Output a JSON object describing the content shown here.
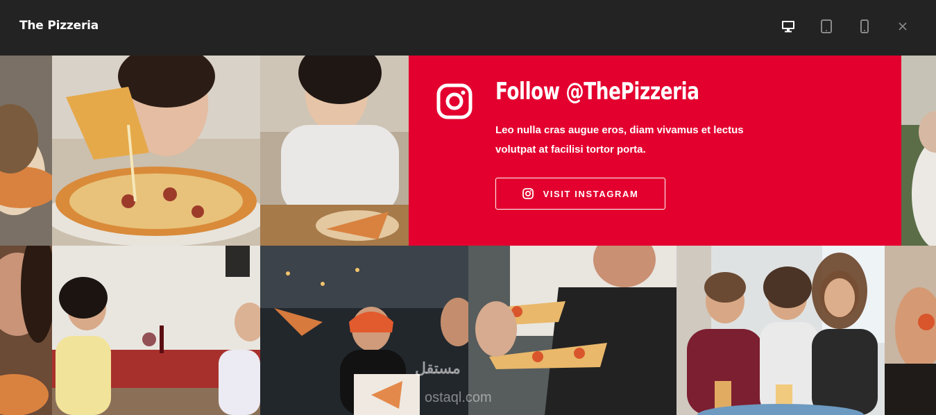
{
  "app": {
    "title": "The Pizzeria"
  },
  "toolbar": {
    "icons": [
      "desktop-icon",
      "tablet-icon",
      "mobile-icon",
      "close-icon"
    ]
  },
  "promo": {
    "title": "Follow @ThePizzeria",
    "text": "Leo nulla cras augue eros, diam vivamus et lectus volutpat at facilisi tortor porta.",
    "button_label": "VISIT INSTAGRAM",
    "background": "#e3002f"
  },
  "watermark": {
    "line1": "مستقل",
    "line2": "ostaql.com"
  },
  "colors": {
    "topbar": "#232323",
    "accent": "#e3002f"
  }
}
